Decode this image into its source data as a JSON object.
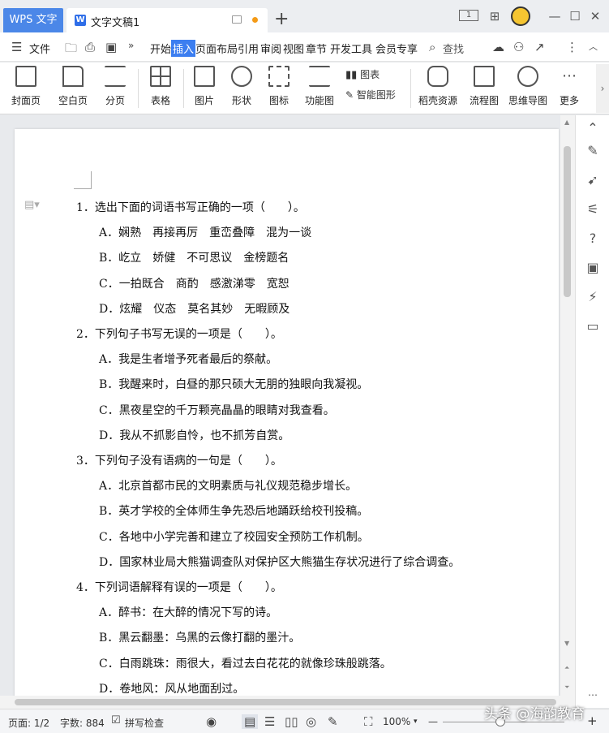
{
  "titlebar": {
    "app_tab": "WPS 文字",
    "doc_tab": "文字文稿1",
    "new_tab": "+",
    "window_badge": "1"
  },
  "menubar": {
    "file": "文件",
    "tabs": [
      "开始",
      "插入",
      "页面布局",
      "引用",
      "审阅",
      "视图",
      "章节",
      "开发工具",
      "会员专享"
    ],
    "active_tab": "插入",
    "search": "查找"
  },
  "ribbon": {
    "items": [
      "封面页",
      "空白页",
      "分页",
      "表格",
      "图片",
      "形状",
      "图标",
      "功能图",
      "图表",
      "智能图形",
      "稻壳资源",
      "流程图",
      "思维导图",
      "更多"
    ]
  },
  "document": {
    "questions": [
      {
        "stem": "1．选出下面的词语书写正确的一项（　　）。",
        "options": [
          "A．娴熟　再接再厉　重峦叠障　混为一谈",
          "B．屹立　娇健　不可思议　金榜题名",
          "C．一拍既合　商酌　感激涕零　宽恕",
          "D．炫耀　仪态　莫名其妙　无暇顾及"
        ]
      },
      {
        "stem": "2．下列句子书写无误的一项是（　　）。",
        "options": [
          "A．我是生者增予死者最后的祭献。",
          "B．我醒来时，白昼的那只硕大无朋的独眼向我凝视。",
          "C．黑夜星空的千万颗亮晶晶的眼睛对我查看。",
          "D．我从不抓影自怜，也不抓芳自赏。"
        ]
      },
      {
        "stem": "3．下列句子没有语病的一句是（　　）。",
        "options": [
          "A．北京首都市民的文明素质与礼仪规范稳步增长。",
          "B．英才学校的全体师生争先恐后地踊跃给校刊投稿。",
          "C．各地中小学完善和建立了校园安全预防工作机制。",
          "D．国家林业局大熊猫调查队对保护区大熊猫生存状况进行了综合调查。"
        ]
      },
      {
        "stem": "4．下列词语解释有误的一项是（　　）。",
        "options": [
          "A．醉书：在大醉的情况下写的诗。",
          "B．黑云翻墨：乌黑的云像打翻的墨汁。",
          "C．白雨跳珠：雨很大，看过去白花花的就像珍珠般跳落。",
          "D．卷地风：风从地面刮过。"
        ]
      }
    ]
  },
  "statusbar": {
    "page": "页面: 1/2",
    "words": "字数: 884",
    "spellcheck": "拼写检查",
    "zoom": "100%",
    "watermark": "头条 @海韵教育"
  }
}
